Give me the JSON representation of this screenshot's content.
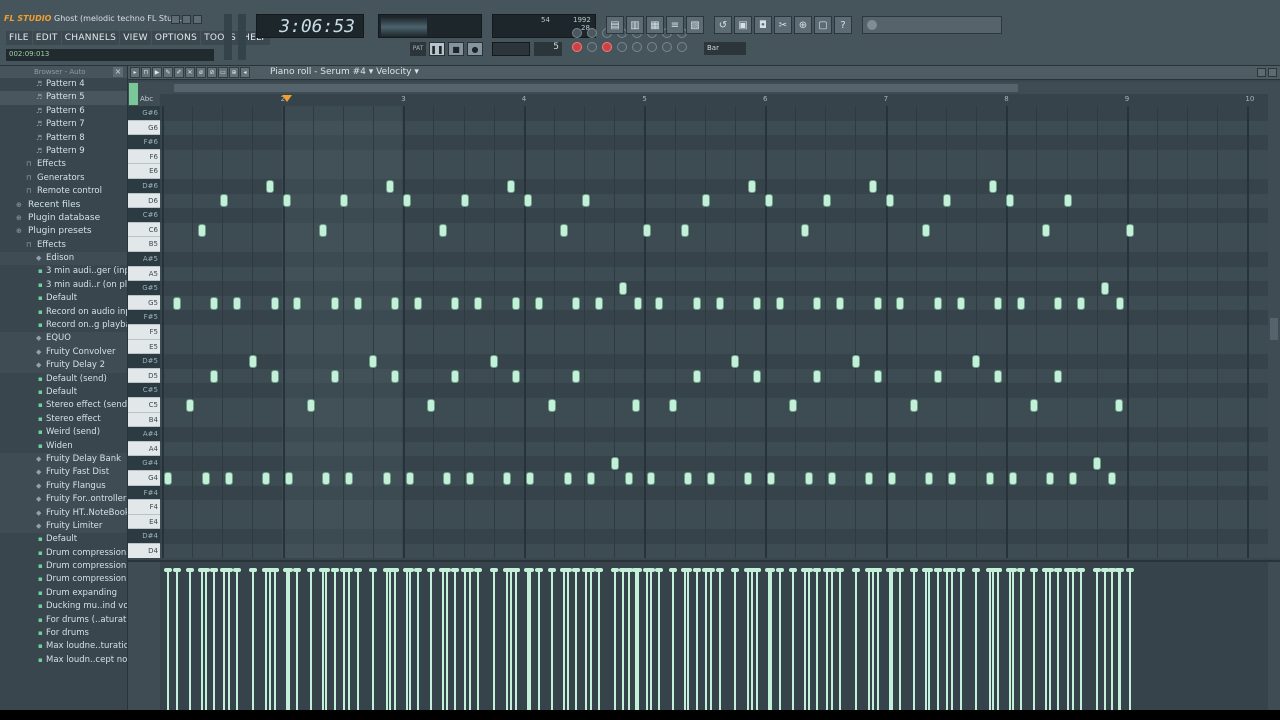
{
  "app": {
    "title": "Ghost (melodic techno FL Studi...",
    "logo": "FL STUDIO",
    "hint": "002:09:013"
  },
  "menu": [
    "FILE",
    "EDIT",
    "CHANNELS",
    "VIEW",
    "OPTIONS",
    "TOOLS",
    "HELP"
  ],
  "transport": {
    "time": "3:06:53",
    "tempo": "",
    "step": "5",
    "cpu_top": "54",
    "cpu_right": "1992",
    "cpu_bottom": "28",
    "snap": "Bar"
  },
  "browser": {
    "header": "Browser - Auto",
    "items": [
      {
        "label": "Pattern 4",
        "indent": 2,
        "type": "pattern"
      },
      {
        "label": "Pattern 5",
        "indent": 2,
        "type": "pattern",
        "selected": true
      },
      {
        "label": "Pattern 6",
        "indent": 2,
        "type": "pattern"
      },
      {
        "label": "Pattern 7",
        "indent": 2,
        "type": "pattern"
      },
      {
        "label": "Pattern 8",
        "indent": 2,
        "type": "pattern"
      },
      {
        "label": "Pattern 9",
        "indent": 2,
        "type": "pattern"
      },
      {
        "label": "Effects",
        "indent": 1,
        "type": "folder"
      },
      {
        "label": "Generators",
        "indent": 1,
        "type": "folder"
      },
      {
        "label": "Remote control",
        "indent": 1,
        "type": "folder"
      },
      {
        "label": "Recent files",
        "indent": 0,
        "type": "header"
      },
      {
        "label": "Plugin database",
        "indent": 0,
        "type": "header"
      },
      {
        "label": "Plugin presets",
        "indent": 0,
        "type": "header"
      },
      {
        "label": "Effects",
        "indent": 1,
        "type": "folder"
      },
      {
        "label": "Edison",
        "indent": 2,
        "type": "group"
      },
      {
        "label": "3 min audi..ger (input)",
        "indent": 3,
        "type": "preset"
      },
      {
        "label": "3 min audi..r (on play)",
        "indent": 3,
        "type": "preset"
      },
      {
        "label": "Default",
        "indent": 3,
        "type": "preset"
      },
      {
        "label": "Record on audio input",
        "indent": 3,
        "type": "preset"
      },
      {
        "label": "Record on..g playback",
        "indent": 3,
        "type": "preset"
      },
      {
        "label": "EQUO",
        "indent": 2,
        "type": "group"
      },
      {
        "label": "Fruity Convolver",
        "indent": 2,
        "type": "group"
      },
      {
        "label": "Fruity Delay 2",
        "indent": 2,
        "type": "group"
      },
      {
        "label": "Default (send)",
        "indent": 3,
        "type": "preset"
      },
      {
        "label": "Default",
        "indent": 3,
        "type": "preset"
      },
      {
        "label": "Stereo effect (send)",
        "indent": 3,
        "type": "preset"
      },
      {
        "label": "Stereo effect",
        "indent": 3,
        "type": "preset"
      },
      {
        "label": "Weird (send)",
        "indent": 3,
        "type": "preset"
      },
      {
        "label": "Widen",
        "indent": 3,
        "type": "preset"
      },
      {
        "label": "Fruity Delay Bank",
        "indent": 2,
        "type": "group"
      },
      {
        "label": "Fruity Fast Dist",
        "indent": 2,
        "type": "group"
      },
      {
        "label": "Fruity Flangus",
        "indent": 2,
        "type": "group"
      },
      {
        "label": "Fruity For..ontroller",
        "indent": 2,
        "type": "group"
      },
      {
        "label": "Fruity HT..NoteBook",
        "indent": 2,
        "type": "group"
      },
      {
        "label": "Fruity Limiter",
        "indent": 2,
        "type": "group"
      },
      {
        "label": "Default",
        "indent": 3,
        "type": "preset"
      },
      {
        "label": "Drum compression 2",
        "indent": 3,
        "type": "preset"
      },
      {
        "label": "Drum compression 3",
        "indent": 3,
        "type": "preset"
      },
      {
        "label": "Drum compression",
        "indent": 3,
        "type": "preset"
      },
      {
        "label": "Drum expanding",
        "indent": 3,
        "type": "preset"
      },
      {
        "label": "Ducking mu..ind voice",
        "indent": 3,
        "type": "preset"
      },
      {
        "label": "For drums (..aturation)",
        "indent": 3,
        "type": "preset"
      },
      {
        "label": "For drums",
        "indent": 3,
        "type": "preset"
      },
      {
        "label": "Max loudne..turation)",
        "indent": 3,
        "type": "preset"
      },
      {
        "label": "Max loudn..cept noise",
        "indent": 3,
        "type": "preset"
      }
    ]
  },
  "piano_roll": {
    "title": "Piano roll - Serum #4",
    "target": "Velocity",
    "bar_numbers": [
      "2",
      "3",
      "4",
      "5",
      "6",
      "7",
      "8",
      "9",
      "10"
    ],
    "keys": [
      "G#6",
      "G6",
      "F#6",
      "F6",
      "E6",
      "D#6",
      "D6",
      "C#6",
      "C6",
      "B5",
      "A#5",
      "A5",
      "G#5",
      "G5",
      "F#5",
      "F5",
      "E5",
      "D#5",
      "D5",
      "C#5",
      "C5",
      "B4",
      "A#4",
      "A4",
      "G#4",
      "G4",
      "F#4",
      "F4",
      "E4",
      "D#4",
      "D4"
    ],
    "black_keys": [
      "G#6",
      "F#6",
      "D#6",
      "C#6",
      "A#5",
      "G#5",
      "F#5",
      "D#5",
      "C#5",
      "A#4",
      "G#4",
      "F#4",
      "D#4"
    ],
    "notes": [
      {
        "key": "D#6",
        "t": 0.86
      },
      {
        "key": "D6",
        "t": 0.48
      },
      {
        "key": "D6",
        "t": 1.0
      },
      {
        "key": "C6",
        "t": 0.3
      },
      {
        "key": "D#6",
        "t": 1.86
      },
      {
        "key": "D6",
        "t": 1.48
      },
      {
        "key": "D6",
        "t": 2.0
      },
      {
        "key": "C6",
        "t": 1.3
      },
      {
        "key": "D#6",
        "t": 2.86
      },
      {
        "key": "D6",
        "t": 2.48
      },
      {
        "key": "D6",
        "t": 3.0
      },
      {
        "key": "C6",
        "t": 2.3
      },
      {
        "key": "D6",
        "t": 3.48
      },
      {
        "key": "C6",
        "t": 3.3
      },
      {
        "key": "C6",
        "t": 3.99
      },
      {
        "key": "C6",
        "t": 4.3
      },
      {
        "key": "D#6",
        "t": 4.86
      },
      {
        "key": "D6",
        "t": 4.48
      },
      {
        "key": "D6",
        "t": 5.0
      },
      {
        "key": "C6",
        "t": 5.3
      },
      {
        "key": "D#6",
        "t": 5.86
      },
      {
        "key": "D6",
        "t": 5.48
      },
      {
        "key": "D6",
        "t": 6.0
      },
      {
        "key": "C6",
        "t": 6.3
      },
      {
        "key": "D#6",
        "t": 6.86
      },
      {
        "key": "D6",
        "t": 6.48
      },
      {
        "key": "D6",
        "t": 7.0
      },
      {
        "key": "C6",
        "t": 7.3
      },
      {
        "key": "D6",
        "t": 7.48
      },
      {
        "key": "C6",
        "t": 7.99
      },
      {
        "key": "G5",
        "t": 0.09
      },
      {
        "key": "G5",
        "t": 0.4
      },
      {
        "key": "G5",
        "t": 0.59
      },
      {
        "key": "G5",
        "t": 0.9
      },
      {
        "key": "G5",
        "t": 1.09
      },
      {
        "key": "G5",
        "t": 1.4
      },
      {
        "key": "G5",
        "t": 1.59
      },
      {
        "key": "G5",
        "t": 1.9
      },
      {
        "key": "G5",
        "t": 2.09
      },
      {
        "key": "G5",
        "t": 2.4
      },
      {
        "key": "G5",
        "t": 2.59
      },
      {
        "key": "G5",
        "t": 2.9
      },
      {
        "key": "G5",
        "t": 3.09
      },
      {
        "key": "G5",
        "t": 3.4
      },
      {
        "key": "G5",
        "t": 3.59
      },
      {
        "key": "G#5",
        "t": 3.79
      },
      {
        "key": "G5",
        "t": 3.91
      },
      {
        "key": "G5",
        "t": 4.09
      },
      {
        "key": "G5",
        "t": 4.4
      },
      {
        "key": "G5",
        "t": 4.59
      },
      {
        "key": "G5",
        "t": 4.9
      },
      {
        "key": "G5",
        "t": 5.09
      },
      {
        "key": "G5",
        "t": 5.4
      },
      {
        "key": "G5",
        "t": 5.59
      },
      {
        "key": "G5",
        "t": 5.9
      },
      {
        "key": "G5",
        "t": 6.09
      },
      {
        "key": "G5",
        "t": 6.4
      },
      {
        "key": "G5",
        "t": 6.59
      },
      {
        "key": "G5",
        "t": 6.9
      },
      {
        "key": "G5",
        "t": 7.09
      },
      {
        "key": "G5",
        "t": 7.4
      },
      {
        "key": "G5",
        "t": 7.59
      },
      {
        "key": "G#5",
        "t": 7.79
      },
      {
        "key": "G5",
        "t": 7.91
      },
      {
        "key": "D#5",
        "t": 0.72
      },
      {
        "key": "D5",
        "t": 0.4
      },
      {
        "key": "D5",
        "t": 0.9
      },
      {
        "key": "C5",
        "t": 0.2
      },
      {
        "key": "D#5",
        "t": 1.72
      },
      {
        "key": "D5",
        "t": 1.4
      },
      {
        "key": "D5",
        "t": 1.9
      },
      {
        "key": "C5",
        "t": 1.2
      },
      {
        "key": "D#5",
        "t": 2.72
      },
      {
        "key": "D5",
        "t": 2.4
      },
      {
        "key": "D5",
        "t": 2.9
      },
      {
        "key": "C5",
        "t": 2.2
      },
      {
        "key": "D5",
        "t": 3.4
      },
      {
        "key": "C5",
        "t": 3.2
      },
      {
        "key": "C5",
        "t": 3.9
      },
      {
        "key": "C5",
        "t": 4.2
      },
      {
        "key": "D#5",
        "t": 4.72
      },
      {
        "key": "D5",
        "t": 4.4
      },
      {
        "key": "D5",
        "t": 4.9
      },
      {
        "key": "C5",
        "t": 5.2
      },
      {
        "key": "D#5",
        "t": 5.72
      },
      {
        "key": "D5",
        "t": 5.4
      },
      {
        "key": "D5",
        "t": 5.9
      },
      {
        "key": "C5",
        "t": 6.2
      },
      {
        "key": "D#5",
        "t": 6.72
      },
      {
        "key": "D5",
        "t": 6.4
      },
      {
        "key": "D5",
        "t": 6.9
      },
      {
        "key": "C5",
        "t": 7.2
      },
      {
        "key": "D5",
        "t": 7.4
      },
      {
        "key": "C5",
        "t": 7.9
      },
      {
        "key": "G4",
        "t": 0.02
      },
      {
        "key": "G4",
        "t": 0.33
      },
      {
        "key": "G4",
        "t": 0.52
      },
      {
        "key": "G4",
        "t": 0.83
      },
      {
        "key": "G4",
        "t": 1.02
      },
      {
        "key": "G4",
        "t": 1.33
      },
      {
        "key": "G4",
        "t": 1.52
      },
      {
        "key": "G4",
        "t": 1.83
      },
      {
        "key": "G4",
        "t": 2.02
      },
      {
        "key": "G4",
        "t": 2.33
      },
      {
        "key": "G4",
        "t": 2.52
      },
      {
        "key": "G4",
        "t": 2.83
      },
      {
        "key": "G4",
        "t": 3.02
      },
      {
        "key": "G4",
        "t": 3.33
      },
      {
        "key": "G4",
        "t": 3.52
      },
      {
        "key": "G#4",
        "t": 3.72
      },
      {
        "key": "G4",
        "t": 3.84
      },
      {
        "key": "G4",
        "t": 4.02
      },
      {
        "key": "G4",
        "t": 4.33
      },
      {
        "key": "G4",
        "t": 4.52
      },
      {
        "key": "G4",
        "t": 4.83
      },
      {
        "key": "G4",
        "t": 5.02
      },
      {
        "key": "G4",
        "t": 5.33
      },
      {
        "key": "G4",
        "t": 5.52
      },
      {
        "key": "G4",
        "t": 5.83
      },
      {
        "key": "G4",
        "t": 6.02
      },
      {
        "key": "G4",
        "t": 6.33
      },
      {
        "key": "G4",
        "t": 6.52
      },
      {
        "key": "G4",
        "t": 6.83
      },
      {
        "key": "G4",
        "t": 7.02
      },
      {
        "key": "G4",
        "t": 7.33
      },
      {
        "key": "G4",
        "t": 7.52
      },
      {
        "key": "G#4",
        "t": 7.72
      },
      {
        "key": "G4",
        "t": 7.84
      }
    ]
  },
  "colors": {
    "accent": "#f0a030",
    "note": "#c4f0da",
    "background": "#3a464d"
  },
  "icons": [
    "piano-icon",
    "pencil-icon",
    "brush-icon",
    "magnet-icon",
    "play-icon",
    "stop-icon",
    "record-icon",
    "search-icon"
  ]
}
